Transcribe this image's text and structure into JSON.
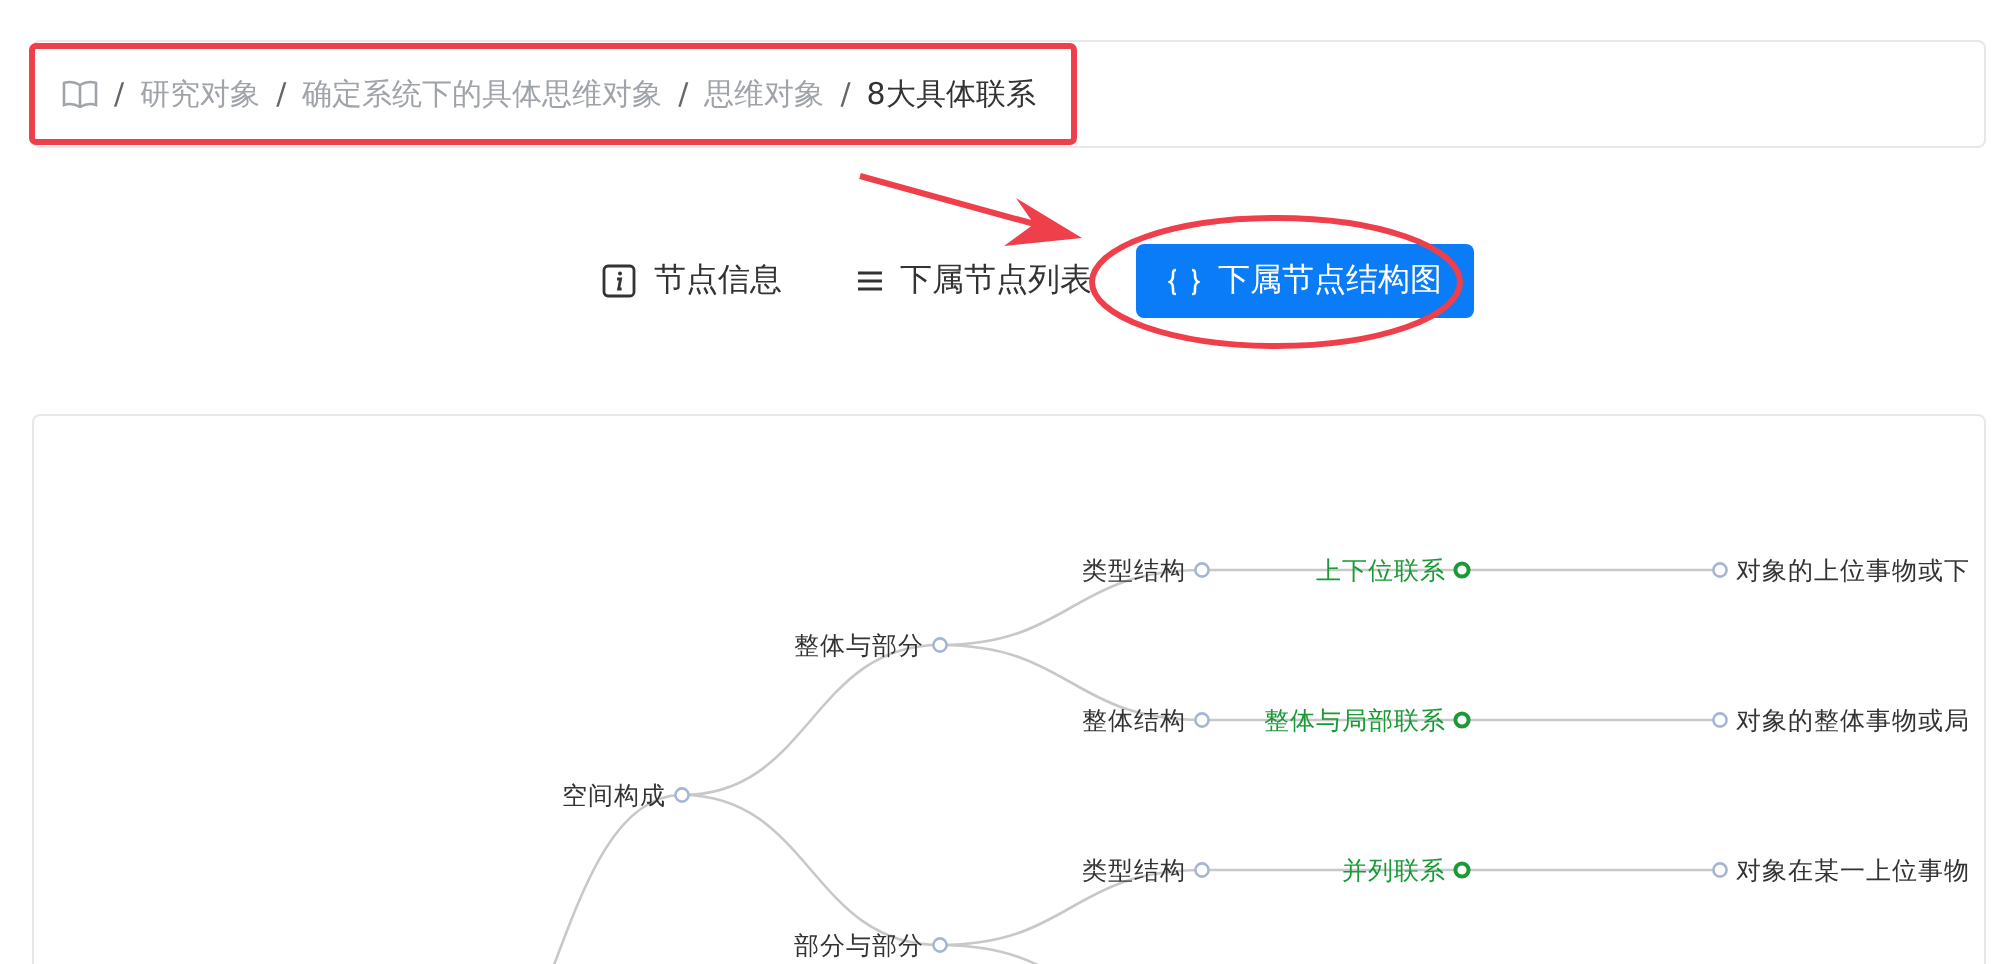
{
  "breadcrumb": {
    "separator": "/",
    "items": [
      {
        "label": "研究对象",
        "current": false
      },
      {
        "label": "确定系统下的具体思维对象",
        "current": false
      },
      {
        "label": "思维对象",
        "current": false
      },
      {
        "label": "8大具体联系",
        "current": true
      }
    ]
  },
  "tabs": [
    {
      "label": "节点信息",
      "kind": "info",
      "selected": false
    },
    {
      "label": "下属节点列表",
      "kind": "list",
      "selected": false
    },
    {
      "label": "下属节点结构图",
      "kind": "braces",
      "selected": true
    }
  ],
  "tree": {
    "label": "空间构成",
    "kind": "topic",
    "parent_below": true,
    "children": [
      {
        "label": "整体与部分",
        "kind": "topic",
        "children": [
          {
            "label": "类型结构",
            "kind": "topic",
            "children": [
              {
                "label": "上下位联系",
                "kind": "relation",
                "children": [
                  {
                    "label": "对象的上位事物或下",
                    "kind": "topic"
                  }
                ]
              }
            ]
          },
          {
            "label": "整体结构",
            "kind": "topic",
            "children": [
              {
                "label": "整体与局部联系",
                "kind": "relation",
                "children": [
                  {
                    "label": "对象的整体事物或局",
                    "kind": "topic"
                  }
                ]
              }
            ]
          }
        ]
      },
      {
        "label": "部分与部分",
        "kind": "topic",
        "more_below": true,
        "children": [
          {
            "label": "类型结构",
            "kind": "topic",
            "children": [
              {
                "label": "并列联系",
                "kind": "relation",
                "children": [
                  {
                    "label": "对象在某一上位事物",
                    "kind": "topic"
                  }
                ]
              }
            ]
          }
        ]
      }
    ]
  }
}
